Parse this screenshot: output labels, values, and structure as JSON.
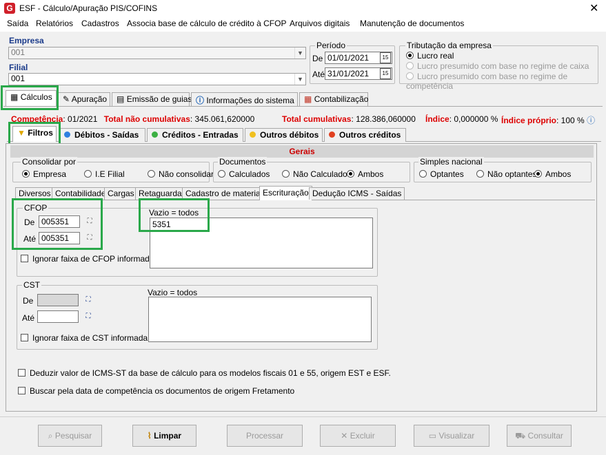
{
  "window": {
    "title": "ESF - Cálculo/Apuração PIS/COFINS",
    "icon_letter": "G",
    "close": "✕"
  },
  "menu": [
    "Saída",
    "Relatórios",
    "Cadastros",
    "Associa base de cálculo de crédito à CFOP",
    "Arquivos digitais",
    "Manutenção de documentos"
  ],
  "empresa": {
    "label": "Empresa",
    "value": "001"
  },
  "filial": {
    "label": "Filial",
    "value": "001"
  },
  "periodo": {
    "title": "Período",
    "de_label": "De",
    "de": "01/01/2021",
    "ate_label": "Até",
    "ate": "31/01/2021",
    "cal_glyph": "15"
  },
  "tributacao": {
    "title": "Tributação da empresa",
    "options": [
      "Lucro real",
      "Lucro presumido com base no regime de caixa",
      "Lucro presumido com base no regime de competência"
    ],
    "selected": 0
  },
  "main_tabs": [
    "Cálculos",
    "Apuração",
    "Emissão de guias",
    "Informações do sistema",
    "Contabilização"
  ],
  "status": {
    "competencia_label": "Competência",
    "competencia": ": 01/2021",
    "nao_cum_label": "Total não cumulativas",
    "nao_cum": ": 345.061,620000",
    "cum_label": "Total cumulativas",
    "cum": ": 128.386,060000",
    "indice_label": "Índice",
    "indice": ": 0,000000 %",
    "indice_proprio_label": "Índice próprio",
    "indice_proprio": ": 100 %"
  },
  "sub_tabs": [
    "Filtros",
    "Débitos - Saídas",
    "Créditos - Entradas",
    "Outros débitos",
    "Outros créditos"
  ],
  "sub_tab_dot_colors": [
    "#2f7fe0",
    "#3cb043",
    "#f0c020",
    "#e04020"
  ],
  "gerais": {
    "title": "Gerais",
    "consolidar": {
      "title": "Consolidar por",
      "options": [
        "Empresa",
        "I.E Filial",
        "Não consolidar"
      ],
      "selected": 0
    },
    "documentos": {
      "title": "Documentos",
      "options": [
        "Calculados",
        "Não Calculados",
        "Ambos"
      ],
      "selected": 2
    },
    "simples": {
      "title": "Simples nacional",
      "options": [
        "Optantes",
        "Não optantes",
        "Ambos"
      ],
      "selected": 2
    }
  },
  "inner_tabs": [
    "Diversos",
    "Contabilidade",
    "Cargas",
    "Retaguarda",
    "Cadastro de materiais",
    "Escrituração",
    "Dedução ICMS - Saídas"
  ],
  "active_inner_tab": 5,
  "cfop": {
    "title": "CFOP",
    "de_label": "De",
    "de": "005351",
    "ate_label": "Até",
    "ate": "005351",
    "vazio_label": "Vazio = todos",
    "list": "5351",
    "ignorar": "Ignorar faixa de CFOP informada"
  },
  "cst": {
    "title": "CST",
    "de_label": "De",
    "de": "",
    "ate_label": "Até",
    "ate": "",
    "vazio_label": "Vazio = todos",
    "ignorar": "Ignorar faixa de CST informada"
  },
  "checks": [
    "Deduzir valor de ICMS-ST da base de cálculo para os modelos fiscais 01 e 55, origem EST e ESF.",
    "Buscar pela data de competência os documentos de origem Fretamento"
  ],
  "buttons": [
    "Pesquisar",
    "Limpar",
    "Processar",
    "Excluir",
    "Visualizar",
    "Consultar"
  ]
}
